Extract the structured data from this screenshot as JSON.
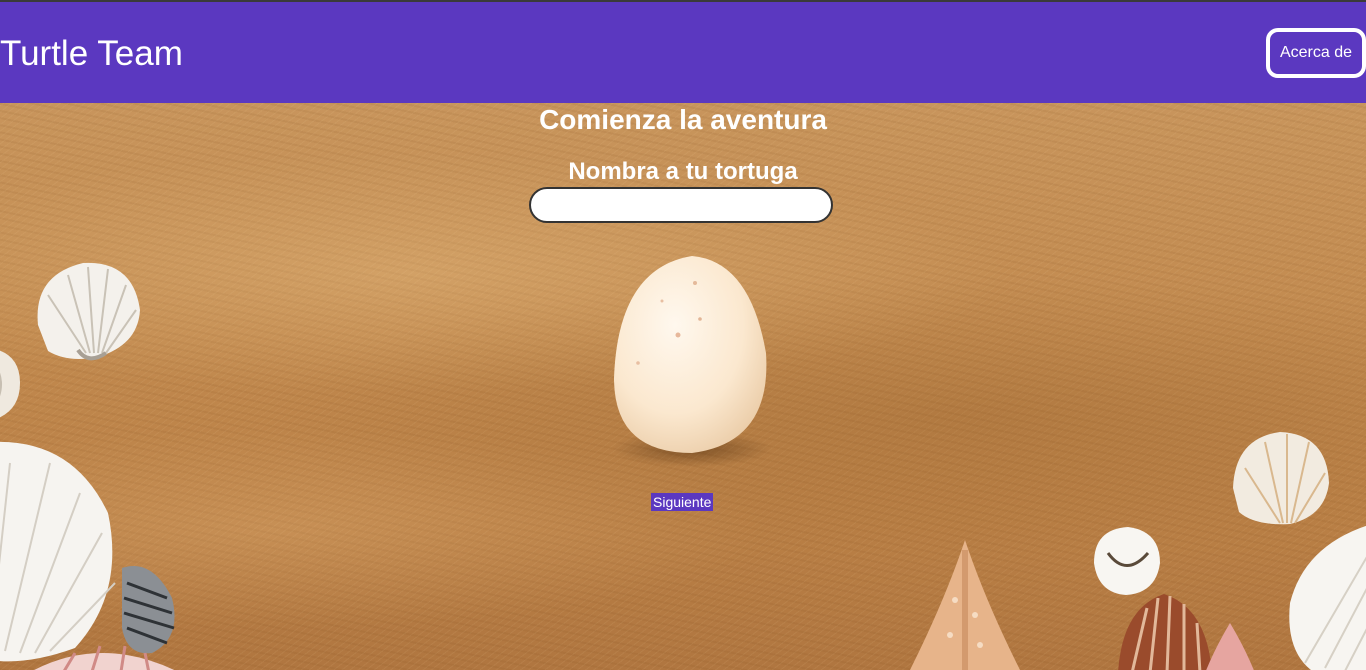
{
  "navbar": {
    "brand": "Turtle Team",
    "about_label": "Acerca de",
    "color": "#5b38c0"
  },
  "main": {
    "title": "Comienza la aventura",
    "name_label": "Nombra a tu tortuga",
    "name_input_value": "",
    "next_label": "Siguiente"
  },
  "background": {
    "description_icon": "sand-with-seashells",
    "sand_color": "#c28a4f"
  },
  "icons": {
    "egg": "egg-icon"
  }
}
